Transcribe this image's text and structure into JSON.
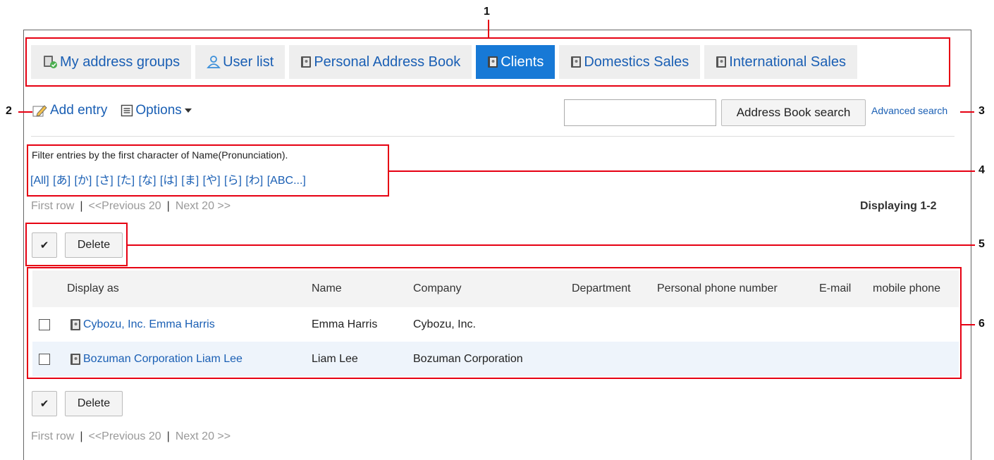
{
  "tabs": [
    {
      "label": "My address groups",
      "icon": "group-book-icon",
      "active": false
    },
    {
      "label": "User list",
      "icon": "user-icon",
      "active": false
    },
    {
      "label": "Personal Address Book",
      "icon": "address-book-icon",
      "active": false
    },
    {
      "label": "Clients",
      "icon": "address-book-icon",
      "active": true
    },
    {
      "label": "Domestics Sales",
      "icon": "address-book-icon",
      "active": false
    },
    {
      "label": "International Sales",
      "icon": "address-book-icon",
      "active": false
    }
  ],
  "toolbar": {
    "add_entry": "Add entry",
    "options": "Options",
    "search_value": "",
    "search_button": "Address Book search",
    "advanced_search": "Advanced search"
  },
  "filter": {
    "title": "Filter entries by the first character of Name(Pronunciation).",
    "items": [
      "[All]",
      "[あ]",
      "[か]",
      "[さ]",
      "[た]",
      "[な]",
      "[は]",
      "[ま]",
      "[や]",
      "[ら]",
      "[わ]",
      "[ABC...]"
    ]
  },
  "pager": {
    "first": "First row",
    "sep": "|",
    "prev": "<<Previous 20",
    "next": "Next 20 >>",
    "displaying": "Displaying 1-2"
  },
  "actions": {
    "check_label": "✔",
    "delete_label": "Delete"
  },
  "table": {
    "headers": [
      "Display as",
      "Name",
      "Company",
      "Department",
      "Personal phone number",
      "E-mail",
      "mobile phone"
    ],
    "rows": [
      {
        "display_as": "Cybozu, Inc. Emma Harris",
        "name": "Emma Harris",
        "company": "Cybozu, Inc."
      },
      {
        "display_as": "Bozuman Corporation Liam Lee",
        "name": "Liam Lee",
        "company": "Bozuman Corporation"
      }
    ]
  },
  "callouts": [
    "1",
    "2",
    "3",
    "4",
    "5",
    "6"
  ],
  "colors": {
    "accent": "#1779d6",
    "link": "#1a5fb4",
    "callout": "#e60012",
    "row_alt": "#eef4fb"
  }
}
